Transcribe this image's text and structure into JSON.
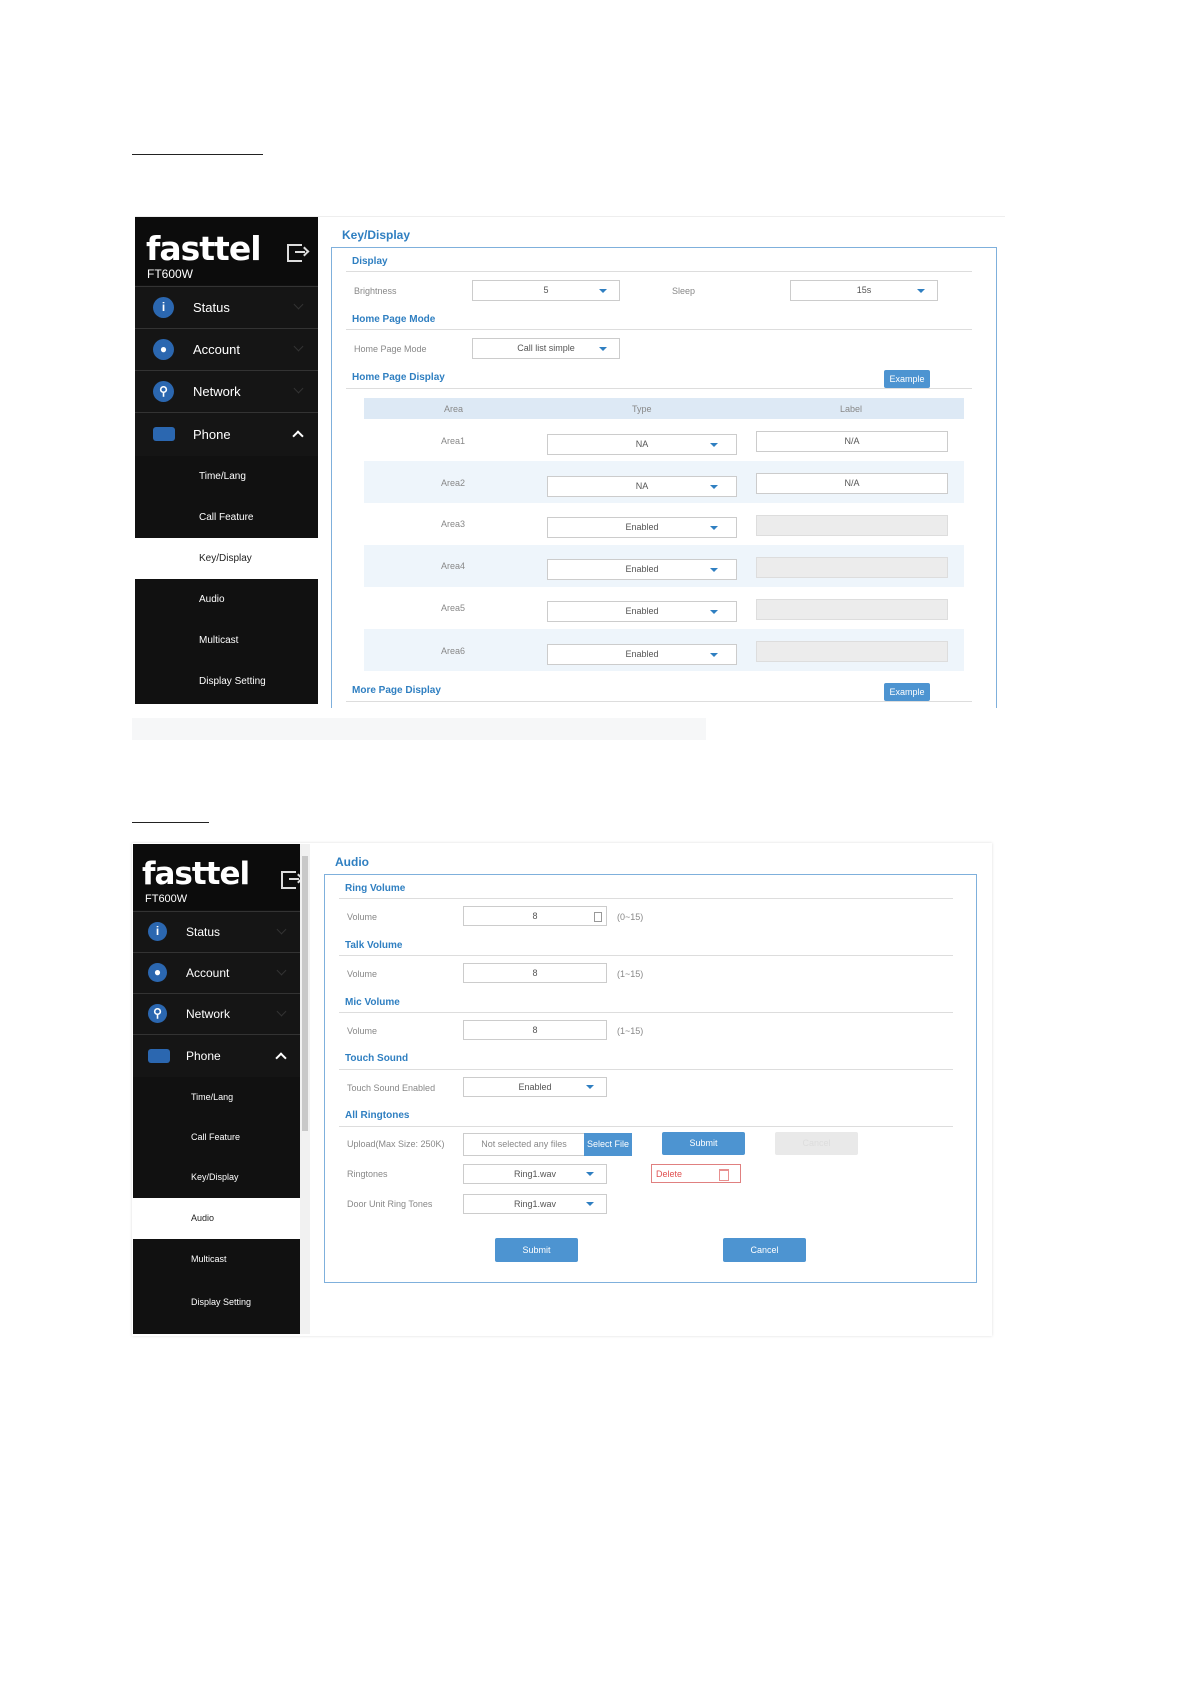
{
  "screen1": {
    "logo": "fasttel",
    "model": "FT600W",
    "nav": {
      "status": "Status",
      "account": "Account",
      "network": "Network",
      "phone": "Phone",
      "sub": [
        "Time/Lang",
        "Call Feature",
        "Key/Display",
        "Audio",
        "Multicast",
        "Display Setting"
      ]
    },
    "title": "Key/Display",
    "display": {
      "section": "Display",
      "brightness_label": "Brightness",
      "brightness_value": "5",
      "sleep_label": "Sleep",
      "sleep_value": "15s"
    },
    "home_page_mode": {
      "section": "Home Page Mode",
      "label": "Home Page Mode",
      "value": "Call list simple"
    },
    "home_page_display": {
      "section": "Home Page Display",
      "example_button": "Example",
      "columns": [
        "Area",
        "Type",
        "Label"
      ],
      "rows": [
        {
          "area": "Area1",
          "type": "NA",
          "label": "N/A"
        },
        {
          "area": "Area2",
          "type": "NA",
          "label": "N/A"
        },
        {
          "area": "Area3",
          "type": "Enabled",
          "label": ""
        },
        {
          "area": "Area4",
          "type": "Enabled",
          "label": ""
        },
        {
          "area": "Area5",
          "type": "Enabled",
          "label": ""
        },
        {
          "area": "Area6",
          "type": "Enabled",
          "label": ""
        }
      ]
    },
    "more_page_display": {
      "section": "More Page Display",
      "example_button": "Example"
    }
  },
  "screen2": {
    "logo": "fasttel",
    "model": "FT600W",
    "nav": {
      "status": "Status",
      "account": "Account",
      "network": "Network",
      "phone": "Phone",
      "sub": [
        "Time/Lang",
        "Call Feature",
        "Key/Display",
        "Audio",
        "Multicast",
        "Display Setting"
      ]
    },
    "title": "Audio",
    "ring_volume": {
      "section": "Ring Volume",
      "label": "Volume",
      "value": "8",
      "range": "(0~15)"
    },
    "talk_volume": {
      "section": "Talk Volume",
      "label": "Volume",
      "value": "8",
      "range": "(1~15)"
    },
    "mic_volume": {
      "section": "Mic Volume",
      "label": "Volume",
      "value": "8",
      "range": "(1~15)"
    },
    "touch_sound": {
      "section": "Touch Sound",
      "label": "Touch Sound Enabled",
      "value": "Enabled"
    },
    "all_ringtones": {
      "section": "All Ringtones",
      "upload_label": "Upload(Max Size: 250K)",
      "file_placeholder": "Not selected any files",
      "select_file": "Select File",
      "submit": "Submit",
      "cancel": "Cancel",
      "ringtones_label": "Ringtones",
      "ringtones_value": "Ring1.wav",
      "delete": "Delete",
      "door_label": "Door Unit Ring Tones",
      "door_value": "Ring1.wav"
    },
    "footer": {
      "submit": "Submit",
      "cancel": "Cancel"
    }
  },
  "colors": {
    "accent": "#2f7fc1",
    "button": "#4d94d1",
    "sidebar": "#111111",
    "icon_blue": "#2b67b0"
  }
}
